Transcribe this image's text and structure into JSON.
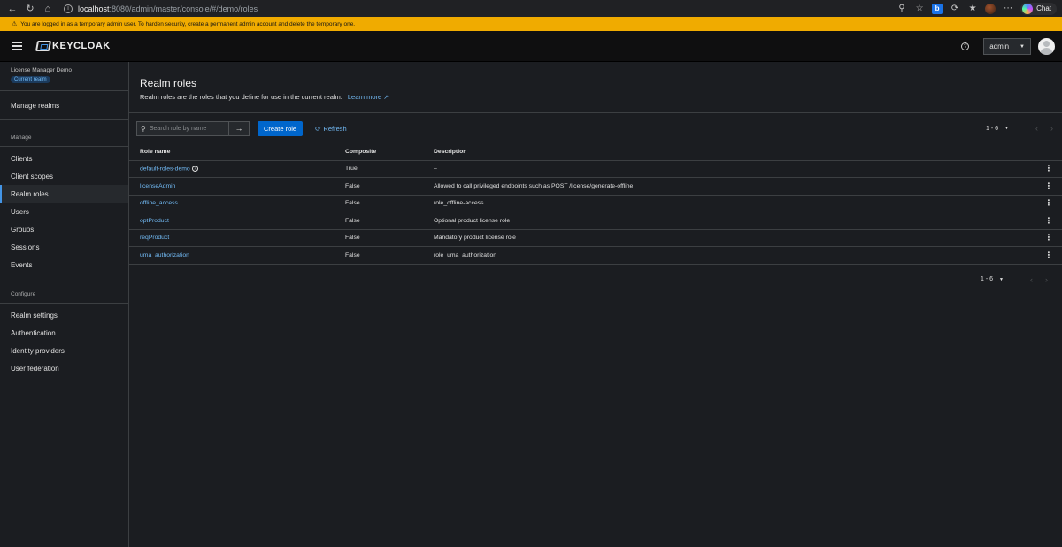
{
  "browser": {
    "url_host": "localhost",
    "url_path": ":8080/admin/master/console/#/demo/roles",
    "chat_label": "Chat"
  },
  "banner": {
    "text": "You are logged in as a temporary admin user. To harden security, create a permanent admin account and delete the temporary one."
  },
  "masthead": {
    "logo_text": "KEYCLOAK",
    "user": "admin"
  },
  "sidebar": {
    "realm_name": "License Manager Demo",
    "realm_badge": "Current realm",
    "manage_realms": "Manage realms",
    "manage_section": "Manage",
    "manage_items": [
      "Clients",
      "Client scopes",
      "Realm roles",
      "Users",
      "Groups",
      "Sessions",
      "Events"
    ],
    "configure_section": "Configure",
    "configure_items": [
      "Realm settings",
      "Authentication",
      "Identity providers",
      "User federation"
    ],
    "active_item": "Realm roles"
  },
  "page": {
    "title": "Realm roles",
    "description": "Realm roles are the roles that you define for use in the current realm.",
    "learn_more": "Learn more"
  },
  "toolbar": {
    "search_placeholder": "Search role by name",
    "create_label": "Create role",
    "refresh_label": "Refresh",
    "pager_text": "1 - 6"
  },
  "table": {
    "headers": [
      "Role name",
      "Composite",
      "Description"
    ],
    "rows": [
      {
        "name": "default-roles-demo",
        "composite": "True",
        "description": "–",
        "help": true
      },
      {
        "name": "licenseAdmin",
        "composite": "False",
        "description": "Allowed to call privileged endpoints such as POST /license/generate-offline"
      },
      {
        "name": "offline_access",
        "composite": "False",
        "description": "role_offline-access"
      },
      {
        "name": "optProduct",
        "composite": "False",
        "description": "Optional product license role"
      },
      {
        "name": "reqProduct",
        "composite": "False",
        "description": "Mandatory product license role"
      },
      {
        "name": "uma_authorization",
        "composite": "False",
        "description": "role_uma_authorization"
      }
    ]
  },
  "bottom_pager": {
    "text": "1 - 6"
  }
}
